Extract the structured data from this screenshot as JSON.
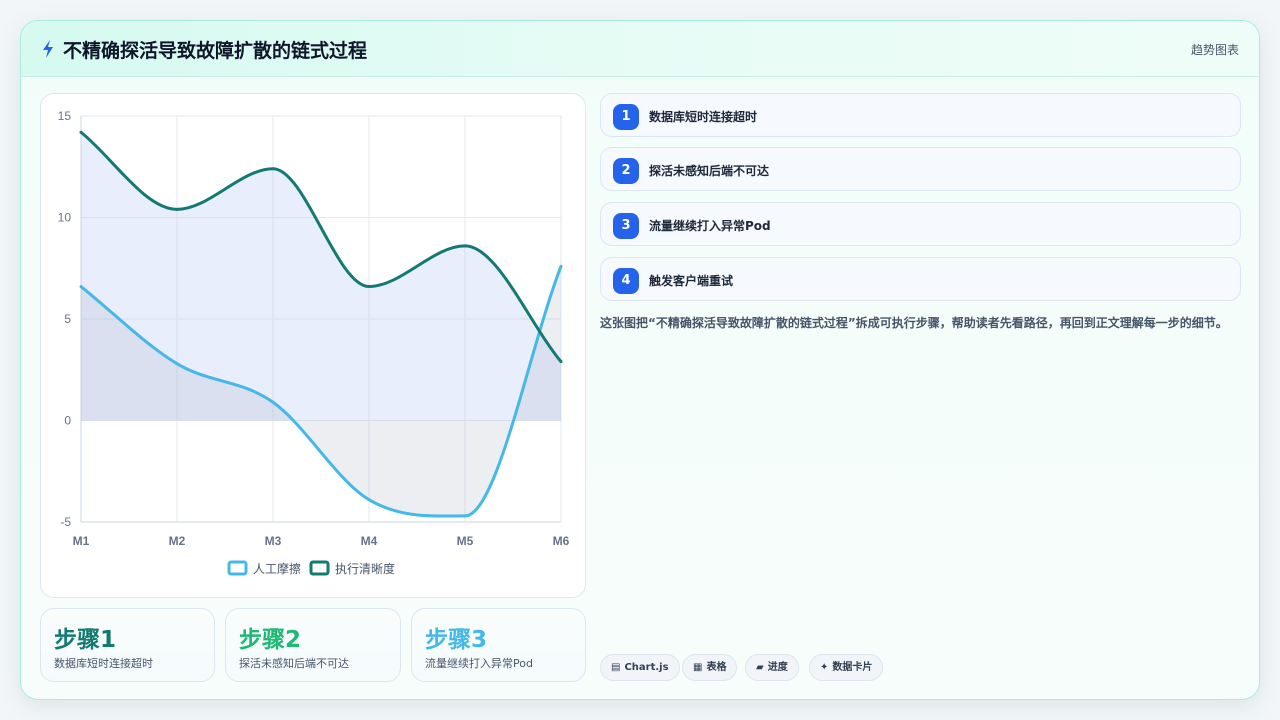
{
  "header": {
    "title": "不精确探活导致故障扩散的链式过程",
    "tag": "趋势图表",
    "icon": "lightning-icon"
  },
  "chart_data": {
    "type": "line",
    "x": [
      "M1",
      "M2",
      "M3",
      "M4",
      "M5",
      "M6"
    ],
    "ylim": [
      -5,
      15
    ],
    "yticks": [
      -5,
      0,
      5,
      10,
      15
    ],
    "grid": true,
    "legend_position": "bottom",
    "series": [
      {
        "name": "人工摩擦",
        "values": [
          6.6,
          2.8,
          0.9,
          -3.9,
          -4.7,
          7.6
        ],
        "color": "#45b8e8",
        "fill": "rgba(148,163,184,0.18)"
      },
      {
        "name": "执行清晰度",
        "values": [
          14.2,
          10.4,
          12.4,
          6.6,
          8.6,
          2.9
        ],
        "color": "#137a72",
        "fill": "rgba(191,207,246,0.35)"
      }
    ]
  },
  "steps": [
    {
      "title": "步骤1",
      "sub": "数据库短时连接超时",
      "color": "#137a72"
    },
    {
      "title": "步骤2",
      "sub": "探活未感知后端不可达",
      "color": "#1fb874"
    },
    {
      "title": "步骤3",
      "sub": "流量继续打入异常Pod",
      "color": "#45b8e8"
    }
  ],
  "list": [
    {
      "num": "1",
      "text": "数据库短时连接超时"
    },
    {
      "num": "2",
      "text": "探活未感知后端不可达"
    },
    {
      "num": "3",
      "text": "流量继续打入异常Pod"
    },
    {
      "num": "4",
      "text": "触发客户端重试"
    }
  ],
  "description": "这张图把“不精确探活导致故障扩散的链式过程”拆成可执行步骤，帮助读者先看路径，再回到正文理解每一步的细节。",
  "chips": [
    {
      "icon": "▤",
      "label": "Chart.js"
    },
    {
      "icon": "▦",
      "label": "表格"
    },
    {
      "icon": "▰",
      "label": "进度"
    },
    {
      "icon": "✦",
      "label": "数据卡片"
    }
  ],
  "colors": {
    "accent": "#2563eb",
    "brand": "#137a72"
  }
}
